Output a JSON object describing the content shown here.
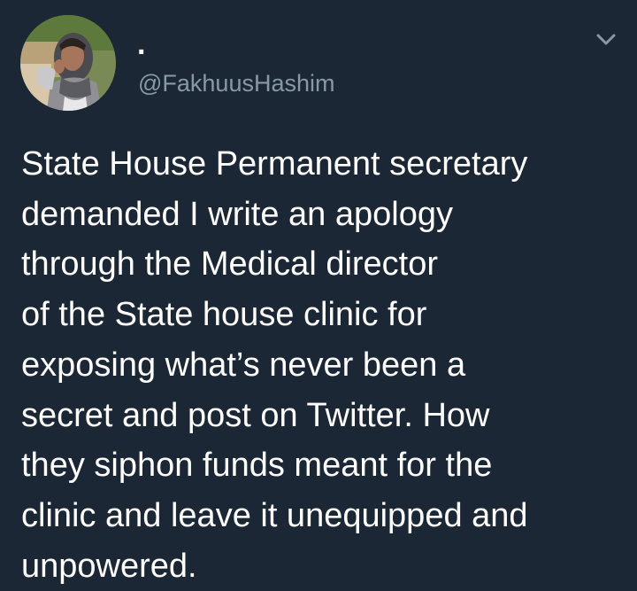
{
  "tweet": {
    "display_name": ".",
    "handle": "@FakhuusHashim",
    "text": "State House Permanent secretary\ndemanded I write an apology\nthrough the Medical director\nof the State house clinic for\nexposing what’s never been a\nsecret and post on Twitter. How\nthey siphon funds meant for the\nclinic and leave it unequipped and\nunpowered.",
    "menu_icon": "chevron-down-icon"
  },
  "colors": {
    "background": "#1c2735",
    "text": "#ffffff",
    "secondary_text": "#8899a6",
    "icon": "#8899a6"
  }
}
